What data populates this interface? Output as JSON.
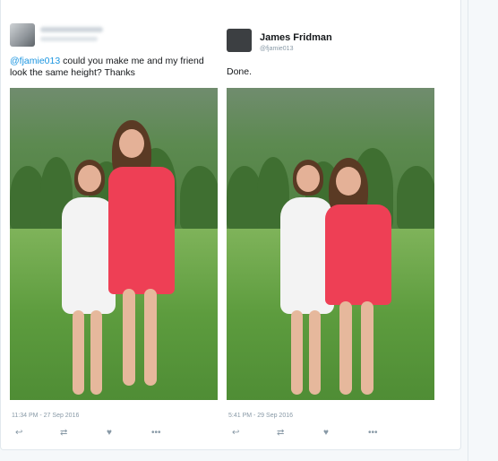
{
  "left_tweet": {
    "mention": "@fjamie013",
    "text": " could you make me and my friend look the same height? Thanks",
    "timestamp": "11:34 PM - 27 Sep 2016"
  },
  "right_tweet": {
    "name": "James Fridman",
    "handle": "@fjamie013",
    "text": "Done.",
    "timestamp": "5:41 PM - 29 Sep 2016"
  },
  "actions": {
    "reply_icon": "reply-icon",
    "retweet_icon": "retweet-icon",
    "like_icon": "heart-icon",
    "more_icon": "more-icon"
  },
  "colors": {
    "link": "#1b95e0",
    "meta": "#8899a6",
    "text": "#14171a",
    "dress_white": "#f3f3f3",
    "dress_red": "#ee3f55"
  }
}
